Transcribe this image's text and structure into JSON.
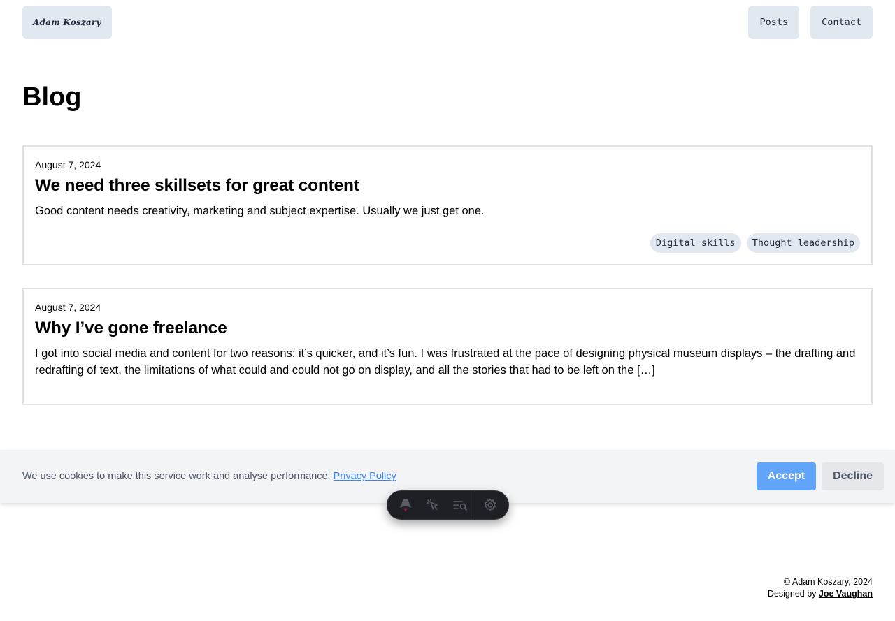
{
  "header": {
    "logo": "Adam Koszary",
    "nav": [
      {
        "label": "Posts"
      },
      {
        "label": "Contact"
      }
    ]
  },
  "page": {
    "title": "Blog"
  },
  "posts": [
    {
      "date": "August 7, 2024",
      "title": "We need three skillsets for great content",
      "excerpt": "Good content needs creativity, marketing and subject expertise. Usually we just get one.",
      "tags": [
        "Digital skills",
        "Thought leadership"
      ]
    },
    {
      "date": "August 7, 2024",
      "title": "Why I’ve gone freelance",
      "excerpt": "I got into social media and content for two reasons: it’s quicker, and it’s fun. I was frustrated at the pace of designing physical museum displays – the drafting and redrafting of text, the limitations of what could and could not go on display, and all the stories that had to be left on the […]",
      "tags": []
    }
  ],
  "cookie_banner": {
    "message": "We use cookies to make this service work and analyse performance.",
    "link_label": "Privacy Policy",
    "accept_label": "Accept",
    "decline_label": "Decline"
  },
  "toolbar": {
    "icons": [
      "astro-logo-icon",
      "inspect-cursor-icon",
      "audit-list-search-icon",
      "gear-icon"
    ]
  },
  "footer": {
    "copyright": "© Adam Koszary, 2024",
    "designed_by_prefix": "Designed by",
    "designer": "Joe Vaughan"
  },
  "colors": {
    "button_bg": "#e2e8f0",
    "accent": "#60a5fa",
    "link": "#3b82f6"
  }
}
